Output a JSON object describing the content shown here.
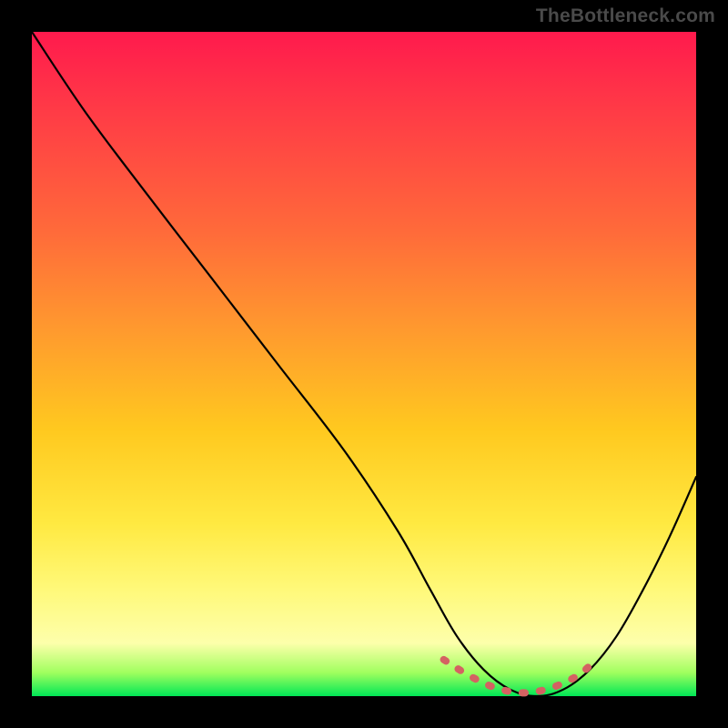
{
  "watermark": "TheBottleneck.com",
  "chart_data": {
    "type": "line",
    "title": "",
    "xlabel": "",
    "ylabel": "",
    "xlim": [
      0,
      100
    ],
    "ylim": [
      0,
      100
    ],
    "series": [
      {
        "name": "bottleneck-curve",
        "x": [
          0,
          8,
          17,
          27,
          37,
          47,
          55,
          60,
          64,
          68,
          72,
          76,
          80,
          84,
          88,
          92,
          96,
          100
        ],
        "y": [
          100,
          88,
          76,
          63,
          50,
          37,
          25,
          16,
          9,
          4,
          1,
          0,
          1,
          4,
          9,
          16,
          24,
          33
        ]
      }
    ],
    "highlight_region": {
      "name": "optimal-zone",
      "x": [
        62,
        66,
        70,
        74,
        78,
        82,
        85
      ],
      "y": [
        5.5,
        3.0,
        1.2,
        0.5,
        1.2,
        3.0,
        5.5
      ]
    },
    "gradient_stops": [
      {
        "pos": 0,
        "color": "#ff1a4d"
      },
      {
        "pos": 0.45,
        "color": "#ff9a2e"
      },
      {
        "pos": 0.74,
        "color": "#ffe941"
      },
      {
        "pos": 0.92,
        "color": "#fdffab"
      },
      {
        "pos": 1.0,
        "color": "#00e756"
      }
    ]
  }
}
